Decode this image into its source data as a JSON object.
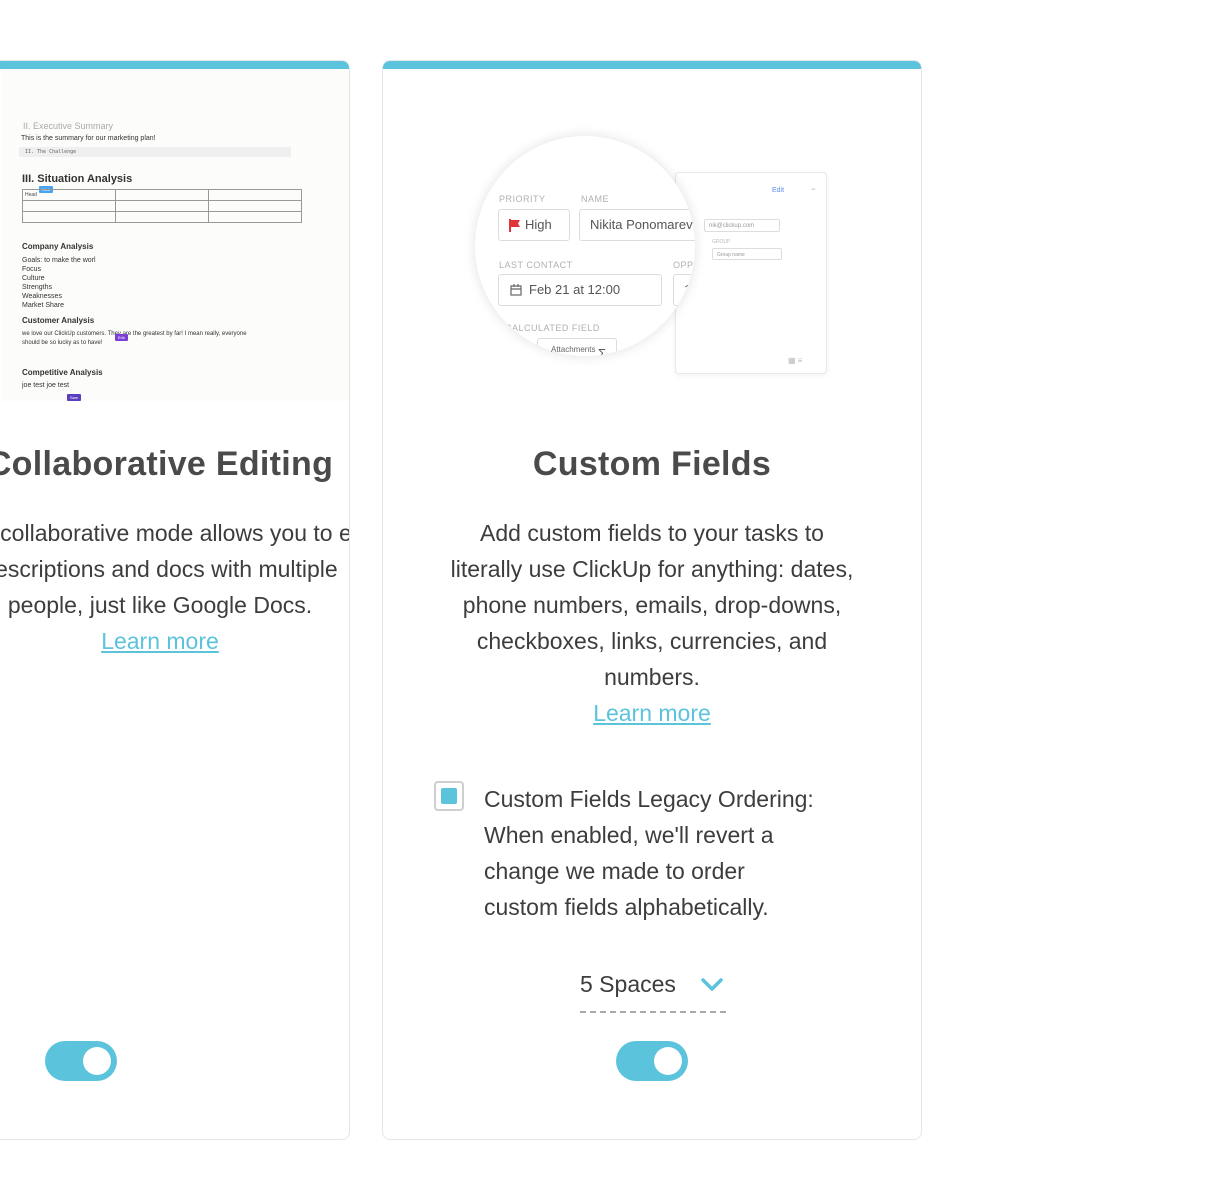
{
  "left_card": {
    "title": "Collaborative Editing",
    "description_lines": [
      "Real-time collaborative mode allows you to edit task",
      "descriptions and docs with multiple",
      "people, just like Google Docs."
    ],
    "learn_more": "Learn more",
    "toggle_on": true,
    "preview": {
      "summary_heading": "II. Executive Summary",
      "summary_text": "This is the summary for our marketing plan!",
      "code_line": "II. The Challenge",
      "situation_heading": "III. Situation Analysis",
      "table_cell": "Head",
      "company_heading": "Company Analysis",
      "company_items": [
        "Goals: to make the worl",
        "Focus",
        "Culture",
        "Strengths",
        "Weaknesses",
        "Market Share"
      ],
      "customer_heading": "Customer Analysis",
      "customer_text_1": "we love our ClickUp customers. They are the greatest by far! I mean really, everyone",
      "customer_text_2": "should be so lucky as to have!",
      "competitive_heading": "Competitive Analysis",
      "competitive_text": "joe test joe test"
    }
  },
  "right_card": {
    "title": "Custom Fields",
    "description_lines": [
      "Add custom fields to your tasks to",
      "literally use ClickUp for anything: dates,",
      "phone numbers, emails, drop-downs,",
      "checkboxes, links, currencies, and",
      "numbers."
    ],
    "learn_more": "Learn more",
    "illustration": {
      "priority_label": "PRIORITY",
      "priority_value": "High",
      "name_label": "NAME",
      "name_value": "Nikita Ponomarev",
      "last_contact_label": "LAST CONTACT",
      "last_contact_value": "Feb 21 at 12:00",
      "opp_label": "OPPO",
      "calculated_label": "CALCULATED FIELD",
      "sigma": "Σ",
      "attachments_label": "Attachments",
      "panel_edit": "Edit",
      "panel_email": "nik@clickup.com",
      "panel_group_label": "GROUP",
      "panel_group_placeholder": "Group name"
    },
    "legacy_checkbox_checked": true,
    "legacy_lines": [
      "Custom Fields Legacy Ordering:",
      "When enabled, we'll revert a",
      "change we made to order",
      "custom fields alphabetically."
    ],
    "spaces_label": "5 Spaces",
    "toggle_on": true
  },
  "colors": {
    "accent": "#5cc3dd",
    "flag": "#e0353b",
    "tag_blue": "#4aa3f0",
    "tag_purple": "#7b3fd6"
  }
}
